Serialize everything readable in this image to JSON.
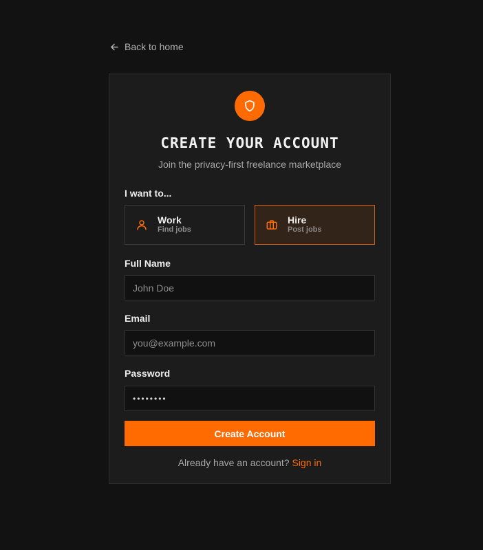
{
  "nav": {
    "back_label": "Back to home"
  },
  "card": {
    "title": "CREATE YOUR ACCOUNT",
    "subtitle": "Join the privacy-first freelance marketplace"
  },
  "role": {
    "label": "I want to...",
    "options": [
      {
        "title": "Work",
        "subtitle": "Find jobs",
        "icon": "user-icon",
        "selected": false
      },
      {
        "title": "Hire",
        "subtitle": "Post jobs",
        "icon": "briefcase-icon",
        "selected": true
      }
    ]
  },
  "form": {
    "full_name": {
      "label": "Full Name",
      "placeholder": "John Doe",
      "value": ""
    },
    "email": {
      "label": "Email",
      "placeholder": "you@example.com",
      "value": ""
    },
    "password": {
      "label": "Password",
      "value": "••••••••"
    },
    "submit_label": "Create Account"
  },
  "footer": {
    "prompt": "Already have an account?",
    "link_label": "Sign in"
  },
  "colors": {
    "accent": "#ff6b00",
    "background": "#121212",
    "card": "#1c1c1c",
    "selected_bg": "#33241a"
  }
}
